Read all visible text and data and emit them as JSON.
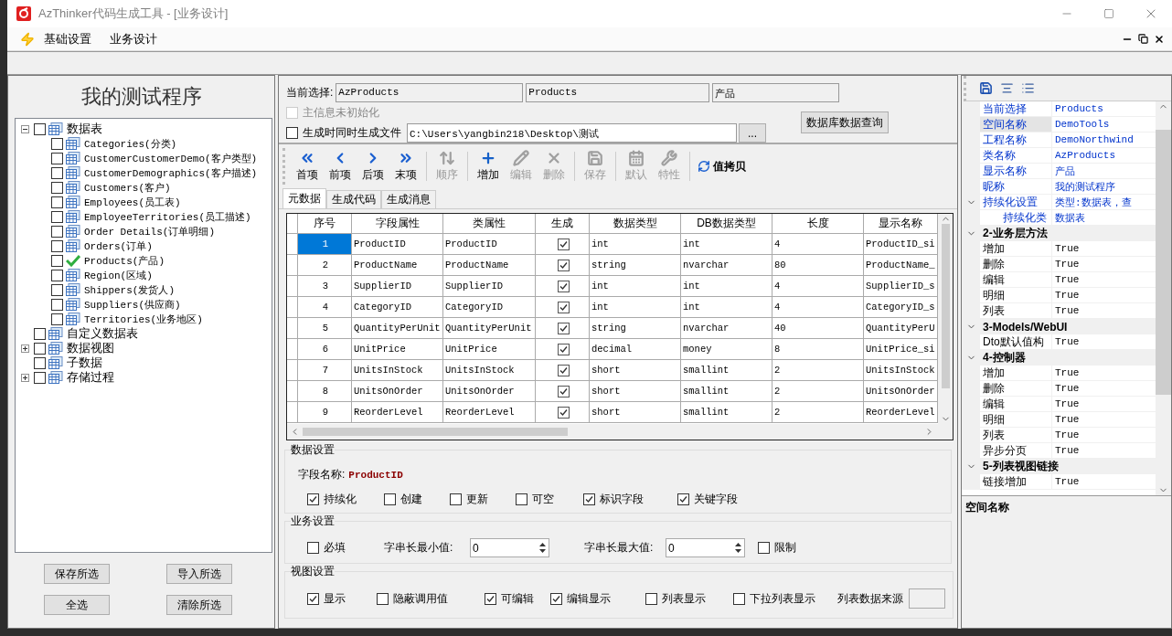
{
  "window": {
    "title": "AzThinker代码生成工具 - [业务设计]"
  },
  "menu": [
    {
      "label": "基础设置"
    },
    {
      "label": "业务设计"
    }
  ],
  "project": {
    "title": "我的测试程序"
  },
  "tree": [
    {
      "label": "数据表",
      "checked": false,
      "expanded": true,
      "children": [
        {
          "label": "Categories(分类)",
          "checked": false,
          "generated": false
        },
        {
          "label": "CustomerCustomerDemo(客户类型)",
          "checked": false,
          "generated": false
        },
        {
          "label": "CustomerDemographics(客户描述)",
          "checked": false,
          "generated": false
        },
        {
          "label": "Customers(客户)",
          "checked": false,
          "generated": false
        },
        {
          "label": "Employees(员工表)",
          "checked": false,
          "generated": false
        },
        {
          "label": "EmployeeTerritories(员工描述)",
          "checked": false,
          "generated": false
        },
        {
          "label": "Order Details(订单明细)",
          "checked": false,
          "generated": false
        },
        {
          "label": "Orders(订单)",
          "checked": false,
          "generated": false
        },
        {
          "label": "Products(产品)",
          "checked": false,
          "generated": true
        },
        {
          "label": "Region(区域)",
          "checked": false,
          "generated": false
        },
        {
          "label": "Shippers(发货人)",
          "checked": false,
          "generated": false
        },
        {
          "label": "Suppliers(供应商)",
          "checked": false,
          "generated": false
        },
        {
          "label": "Territories(业务地区)",
          "checked": false,
          "generated": false
        }
      ]
    },
    {
      "label": "自定义数据表",
      "checked": false
    },
    {
      "label": "数据视图",
      "checked": false,
      "expanded": false
    },
    {
      "label": "子数据",
      "checked": false
    },
    {
      "label": "存储过程",
      "checked": false,
      "expanded": false
    }
  ],
  "left_buttons": [
    "保存所选",
    "导入所选",
    "全选",
    "清除所选"
  ],
  "selection": {
    "label": "当前选择:",
    "fields": [
      "AzProducts",
      "Products",
      "产品"
    ],
    "uninitialized": {
      "label": "主信息未初始化",
      "checked": false,
      "disabled": true
    },
    "generate_files": {
      "label": "生成时同时生成文件",
      "checked": false,
      "disabled": false
    },
    "path": "C:\\Users\\yangbin218\\Desktop\\测试",
    "browse_button": "...",
    "query_button": "数据库数据查询"
  },
  "toolbar": [
    [
      {
        "label": "首项",
        "disabled": false
      },
      {
        "label": "前项",
        "disabled": false
      },
      {
        "label": "后项",
        "disabled": false
      },
      {
        "label": "末项",
        "disabled": false
      }
    ],
    [
      {
        "label": "顺序",
        "disabled": true
      }
    ],
    [
      {
        "label": "增加",
        "disabled": false
      },
      {
        "label": "编辑",
        "disabled": true
      },
      {
        "label": "删除",
        "disabled": true
      }
    ],
    [
      {
        "label": "保存",
        "disabled": true
      }
    ],
    [
      {
        "label": "默认",
        "disabled": true
      },
      {
        "label": "特性",
        "disabled": true
      }
    ],
    [
      {
        "label": "值拷贝",
        "disabled": false
      }
    ]
  ],
  "tabs": [
    {
      "label": "元数据",
      "selected": true
    },
    {
      "label": "生成代码",
      "selected": false
    },
    {
      "label": "生成消息",
      "selected": false
    }
  ],
  "grid": {
    "columns": [
      "序号",
      "字段属性",
      "类属性",
      "生成",
      "数据类型",
      "DB数据类型",
      "长度",
      "显示名称"
    ],
    "rows": [
      {
        "no": "1",
        "field": "ProductID",
        "class_prop": "ProductID",
        "generate": true,
        "type": "int",
        "db_type": "int",
        "length": "4",
        "display": "ProductID_si",
        "selected": true
      },
      {
        "no": "2",
        "field": "ProductName",
        "class_prop": "ProductName",
        "generate": true,
        "type": "string",
        "db_type": "nvarchar",
        "length": "80",
        "display": "ProductName_",
        "selected": false
      },
      {
        "no": "3",
        "field": "SupplierID",
        "class_prop": "SupplierID",
        "generate": true,
        "type": "int",
        "db_type": "int",
        "length": "4",
        "display": "SupplierID_s",
        "selected": false
      },
      {
        "no": "4",
        "field": "CategoryID",
        "class_prop": "CategoryID",
        "generate": true,
        "type": "int",
        "db_type": "int",
        "length": "4",
        "display": "CategoryID_s",
        "selected": false
      },
      {
        "no": "5",
        "field": "QuantityPerUnit",
        "class_prop": "QuantityPerUnit",
        "generate": true,
        "type": "string",
        "db_type": "nvarchar",
        "length": "40",
        "display": "QuantityPerU",
        "selected": false
      },
      {
        "no": "6",
        "field": "UnitPrice",
        "class_prop": "UnitPrice",
        "generate": true,
        "type": "decimal",
        "db_type": "money",
        "length": "8",
        "display": "UnitPrice_si",
        "selected": false
      },
      {
        "no": "7",
        "field": "UnitsInStock",
        "class_prop": "UnitsInStock",
        "generate": true,
        "type": "short",
        "db_type": "smallint",
        "length": "2",
        "display": "UnitsInStock",
        "selected": false
      },
      {
        "no": "8",
        "field": "UnitsOnOrder",
        "class_prop": "UnitsOnOrder",
        "generate": true,
        "type": "short",
        "db_type": "smallint",
        "length": "2",
        "display": "UnitsOnOrder",
        "selected": false
      },
      {
        "no": "9",
        "field": "ReorderLevel",
        "class_prop": "ReorderLevel",
        "generate": true,
        "type": "short",
        "db_type": "smallint",
        "length": "2",
        "display": "ReorderLevel",
        "selected": false
      }
    ]
  },
  "data_settings": {
    "title": "数据设置",
    "field_label": "字段名称:",
    "field_value": "ProductID",
    "options": [
      {
        "label": "持续化",
        "checked": true
      },
      {
        "label": "创建",
        "checked": false
      },
      {
        "label": "更新",
        "checked": false
      },
      {
        "label": "可空",
        "checked": false
      },
      {
        "label": "标识字段",
        "checked": true
      },
      {
        "label": "关键字段",
        "checked": true
      }
    ]
  },
  "business_settings": {
    "title": "业务设置",
    "required": {
      "label": "必填",
      "checked": false
    },
    "min_label": "字串长最小值:",
    "min_value": "0",
    "max_label": "字串长最大值:",
    "max_value": "0",
    "limit": {
      "label": "限制",
      "checked": false
    }
  },
  "view_settings": {
    "title": "视图设置",
    "options": [
      {
        "label": "显示",
        "checked": true
      },
      {
        "label": "隐蔽调用值",
        "checked": false
      },
      {
        "label": "可编辑",
        "checked": true
      },
      {
        "label": "编辑显示",
        "checked": true
      },
      {
        "label": "列表显示",
        "checked": false
      },
      {
        "label": "下拉列表显示",
        "checked": false
      }
    ],
    "source_label": "列表数据来源"
  },
  "properties": {
    "items": [
      {
        "kind": "item",
        "name": "当前选择",
        "value": "Products",
        "selected": false
      },
      {
        "kind": "item",
        "name": "空间名称",
        "value": "DemoTools",
        "selected": true
      },
      {
        "kind": "item",
        "name": "工程名称",
        "value": "DemoNorthwind",
        "selected": false
      },
      {
        "kind": "item",
        "name": "类名称",
        "value": "AzProducts",
        "selected": false
      },
      {
        "kind": "item",
        "name": "显示名称",
        "value": "产品",
        "selected": false
      },
      {
        "kind": "item",
        "name": "昵称",
        "value": "我的测试程序",
        "selected": false
      },
      {
        "kind": "item",
        "name": "持续化设置",
        "value": "类型:数据表，查",
        "selected": false,
        "expanded": true,
        "children": [
          {
            "kind": "item",
            "name": "持续化类",
            "value": "数据表",
            "selected": false
          }
        ]
      },
      {
        "kind": "category",
        "label": "2-业务层方法",
        "expanded": true,
        "children": [
          {
            "kind": "item",
            "name": "增加",
            "value": "True",
            "selected": false
          },
          {
            "kind": "item",
            "name": "删除",
            "value": "True",
            "selected": false
          },
          {
            "kind": "item",
            "name": "编辑",
            "value": "True",
            "selected": false
          },
          {
            "kind": "item",
            "name": "明细",
            "value": "True",
            "selected": false
          },
          {
            "kind": "item",
            "name": "列表",
            "value": "True",
            "selected": false
          }
        ]
      },
      {
        "kind": "category",
        "label": "3-Models/WebUI",
        "expanded": true,
        "children": [
          {
            "kind": "item",
            "name": "Dto默认值构",
            "value": "True",
            "selected": false
          }
        ]
      },
      {
        "kind": "category",
        "label": "4-控制器",
        "expanded": true,
        "children": [
          {
            "kind": "item",
            "name": "增加",
            "value": "True",
            "selected": false
          },
          {
            "kind": "item",
            "name": "删除",
            "value": "True",
            "selected": false
          },
          {
            "kind": "item",
            "name": "编辑",
            "value": "True",
            "selected": false
          },
          {
            "kind": "item",
            "name": "明细",
            "value": "True",
            "selected": false
          },
          {
            "kind": "item",
            "name": "列表",
            "value": "True",
            "selected": false
          },
          {
            "kind": "item",
            "name": "异步分页",
            "value": "True",
            "selected": false
          }
        ]
      },
      {
        "kind": "category",
        "label": "5-列表视图链接",
        "expanded": true,
        "children": [
          {
            "kind": "item",
            "name": "链接增加",
            "value": "True",
            "selected": false
          }
        ]
      }
    ],
    "description": "空间名称"
  }
}
